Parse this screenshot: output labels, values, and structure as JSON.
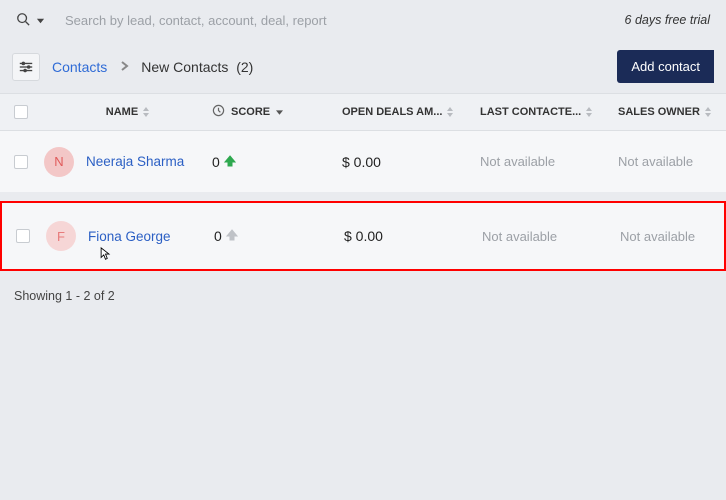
{
  "search": {
    "placeholder": "Search by lead, contact, account, deal, report"
  },
  "trial_text": "6 days free trial",
  "breadcrumb": {
    "link": "Contacts",
    "current": "New Contacts",
    "count_suffix": "(2)"
  },
  "add_button": "Add contact",
  "columns": {
    "name": "NAME",
    "score": "SCORE",
    "deals": "OPEN DEALS AM...",
    "last": "LAST CONTACTE...",
    "owner": "SALES OWNER"
  },
  "rows": [
    {
      "initial": "N",
      "name": "Neeraja Sharma",
      "score": "0",
      "arrow": "green",
      "amount": "$ 0.00",
      "last": "Not available",
      "owner": "Not available",
      "highlight": false
    },
    {
      "initial": "F",
      "name": "Fiona George",
      "score": "0",
      "arrow": "gray",
      "amount": "$ 0.00",
      "last": "Not available",
      "owner": "Not available",
      "highlight": true
    }
  ],
  "footer": "Showing 1 - 2 of 2"
}
